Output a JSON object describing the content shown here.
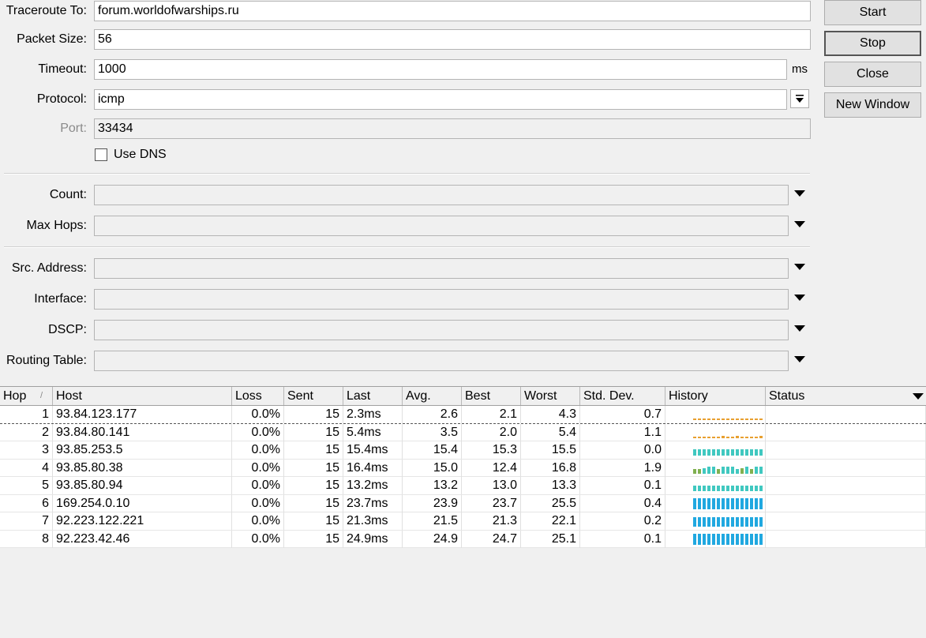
{
  "form": {
    "traceroute_to": {
      "label": "Traceroute To:",
      "value": "forum.worldofwarships.ru"
    },
    "packet_size": {
      "label": "Packet Size:",
      "value": "56"
    },
    "timeout": {
      "label": "Timeout:",
      "value": "1000",
      "unit": "ms"
    },
    "protocol": {
      "label": "Protocol:",
      "value": "icmp"
    },
    "port": {
      "label": "Port:",
      "value": "33434"
    },
    "use_dns": {
      "label": "Use DNS",
      "checked": false
    },
    "count": {
      "label": "Count:",
      "value": ""
    },
    "max_hops": {
      "label": "Max Hops:",
      "value": ""
    },
    "src_address": {
      "label": "Src. Address:",
      "value": ""
    },
    "interface": {
      "label": "Interface:",
      "value": ""
    },
    "dscp": {
      "label": "DSCP:",
      "value": ""
    },
    "routing_table": {
      "label": "Routing Table:",
      "value": ""
    }
  },
  "buttons": {
    "start": "Start",
    "stop": "Stop",
    "close": "Close",
    "new_window": "New Window"
  },
  "table": {
    "sort_indicator": "/",
    "columns": [
      "Hop",
      "Host",
      "Loss",
      "Sent",
      "Last",
      "Avg.",
      "Best",
      "Worst",
      "Std. Dev.",
      "History",
      "Status"
    ],
    "rows": [
      {
        "hop": "1",
        "host": "93.84.123.177",
        "loss": "0.0%",
        "sent": "15",
        "last": "2.3ms",
        "avg": "2.6",
        "best": "2.1",
        "worst": "4.3",
        "stddev": "0.7",
        "status": "",
        "history_color": "#e8a030",
        "history": [
          2,
          2,
          2,
          2,
          2,
          2,
          2,
          2,
          2,
          2,
          2,
          2,
          2,
          2,
          2
        ]
      },
      {
        "hop": "2",
        "host": "93.84.80.141",
        "loss": "0.0%",
        "sent": "15",
        "last": "5.4ms",
        "avg": "3.5",
        "best": "2.0",
        "worst": "5.4",
        "stddev": "1.1",
        "status": "",
        "history_color": "#e8a030",
        "history": [
          2,
          2,
          2,
          2,
          2,
          2,
          3,
          2,
          2,
          3,
          2,
          2,
          2,
          2,
          3
        ]
      },
      {
        "hop": "3",
        "host": "93.85.253.5",
        "loss": "0.0%",
        "sent": "15",
        "last": "15.4ms",
        "avg": "15.4",
        "best": "15.3",
        "worst": "15.5",
        "stddev": "0.0",
        "status": "",
        "history_color": "#40c8c0",
        "history": [
          8,
          8,
          8,
          8,
          8,
          8,
          8,
          8,
          8,
          8,
          8,
          8,
          8,
          8,
          8
        ]
      },
      {
        "hop": "4",
        "host": "93.85.80.38",
        "loss": "0.0%",
        "sent": "15",
        "last": "16.4ms",
        "avg": "15.0",
        "best": "12.4",
        "worst": "16.8",
        "stddev": "1.9",
        "status": "",
        "history_color": "#40c8c0",
        "history": [
          6,
          6,
          7,
          9,
          9,
          6,
          9,
          9,
          9,
          6,
          7,
          9,
          6,
          9,
          9
        ]
      },
      {
        "hop": "5",
        "host": "93.85.80.94",
        "loss": "0.0%",
        "sent": "15",
        "last": "13.2ms",
        "avg": "13.2",
        "best": "13.0",
        "worst": "13.3",
        "stddev": "0.1",
        "status": "",
        "history_color": "#40c8c0",
        "history": [
          7,
          7,
          7,
          7,
          7,
          7,
          7,
          7,
          7,
          7,
          7,
          7,
          7,
          7,
          7
        ]
      },
      {
        "hop": "6",
        "host": "169.254.0.10",
        "loss": "0.0%",
        "sent": "15",
        "last": "23.7ms",
        "avg": "23.9",
        "best": "23.7",
        "worst": "25.5",
        "stddev": "0.4",
        "status": "",
        "history_color": "#20a8e0",
        "history": [
          14,
          14,
          14,
          14,
          14,
          14,
          14,
          14,
          14,
          14,
          14,
          14,
          14,
          14,
          14
        ]
      },
      {
        "hop": "7",
        "host": "92.223.122.221",
        "loss": "0.0%",
        "sent": "15",
        "last": "21.3ms",
        "avg": "21.5",
        "best": "21.3",
        "worst": "22.1",
        "stddev": "0.2",
        "status": "",
        "history_color": "#20a8e0",
        "history": [
          12,
          12,
          12,
          12,
          12,
          12,
          12,
          12,
          12,
          12,
          12,
          12,
          12,
          12,
          12
        ]
      },
      {
        "hop": "8",
        "host": "92.223.42.46",
        "loss": "0.0%",
        "sent": "15",
        "last": "24.9ms",
        "avg": "24.9",
        "best": "24.7",
        "worst": "25.1",
        "stddev": "0.1",
        "status": "",
        "history_color": "#20a8e0",
        "history": [
          14,
          14,
          14,
          14,
          14,
          14,
          14,
          14,
          14,
          14,
          14,
          14,
          14,
          14,
          14
        ]
      }
    ]
  }
}
